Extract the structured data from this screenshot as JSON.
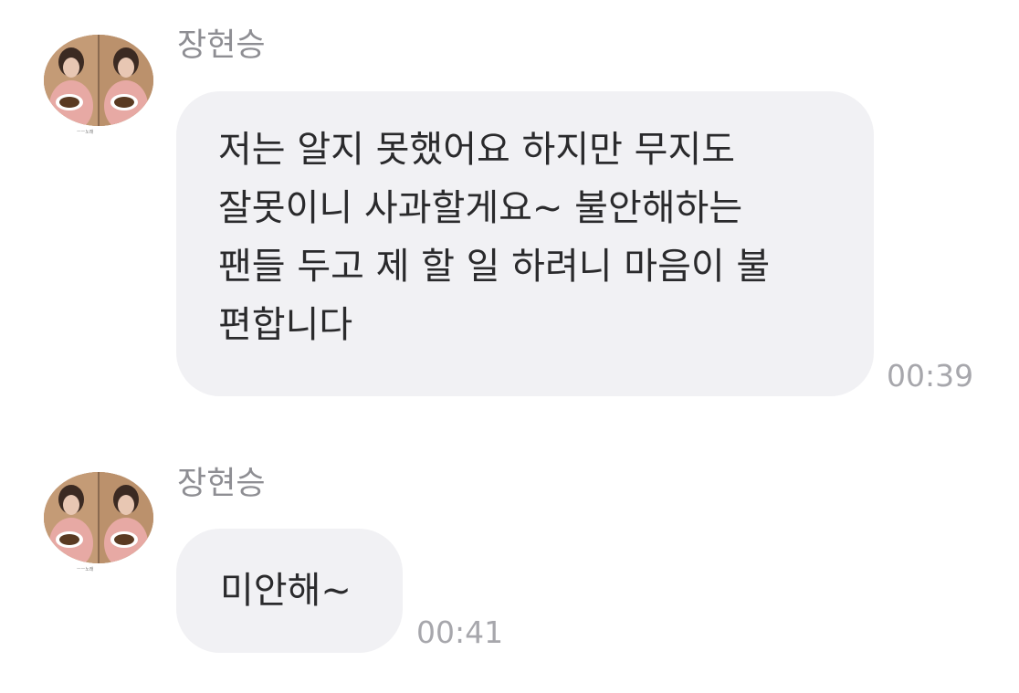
{
  "messages": [
    {
      "sender": "장현승",
      "text": "저는 알지 못했어요 하지만 무지도\n잘못이니 사과할게요~ 불안해하는\n팬들 두고 제 할 일 하려니 마음이 불\n편합니다",
      "time": "00:39",
      "avatar_caption": "ㅡㅡ노래"
    },
    {
      "sender": "장현승",
      "text": "미안해~",
      "time": "00:41",
      "avatar_caption": "ㅡㅡ노래"
    }
  ],
  "colors": {
    "bubble": "#f1f1f4",
    "text": "#2a2a2c",
    "sender": "#8e8e93",
    "time": "#a7a7ac"
  }
}
